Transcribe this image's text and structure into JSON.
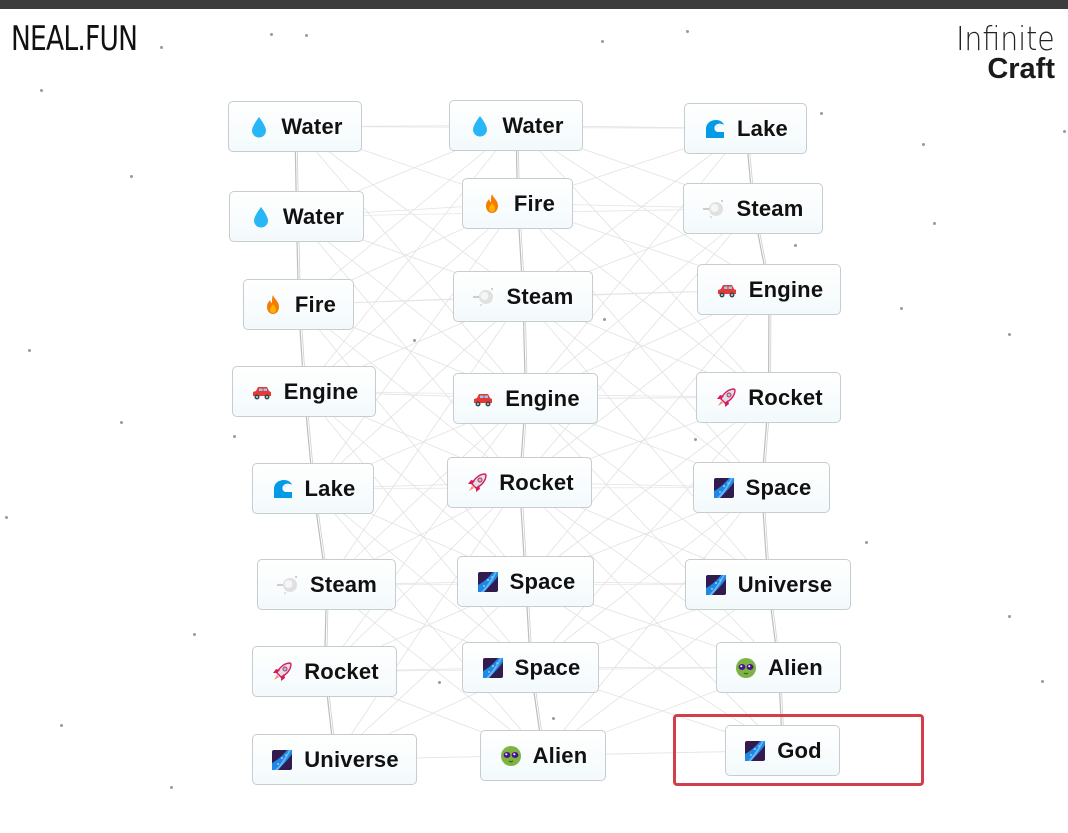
{
  "header": {
    "site_logo": "NEAL.FUN",
    "game_logo_line1": "Infinite",
    "game_logo_line2": "Craft"
  },
  "colors": {
    "topbar": "#3c3c3c",
    "highlight": "#d1404a",
    "item_border": "#c5ccd2",
    "line": "#d4d4d4"
  },
  "columns": [
    {
      "items": [
        {
          "label": "Water",
          "icon": "water-drop-icon"
        },
        {
          "label": "Water",
          "icon": "water-drop-icon"
        },
        {
          "label": "Fire",
          "icon": "fire-icon"
        },
        {
          "label": "Engine",
          "icon": "car-icon"
        },
        {
          "label": "Lake",
          "icon": "wave-icon"
        },
        {
          "label": "Steam",
          "icon": "steam-icon"
        },
        {
          "label": "Rocket",
          "icon": "rocket-icon"
        },
        {
          "label": "Universe",
          "icon": "milky-way-icon"
        }
      ]
    },
    {
      "items": [
        {
          "label": "Water",
          "icon": "water-drop-icon"
        },
        {
          "label": "Fire",
          "icon": "fire-icon"
        },
        {
          "label": "Steam",
          "icon": "steam-icon"
        },
        {
          "label": "Engine",
          "icon": "car-icon"
        },
        {
          "label": "Rocket",
          "icon": "rocket-icon"
        },
        {
          "label": "Space",
          "icon": "milky-way-icon"
        },
        {
          "label": "Space",
          "icon": "milky-way-icon"
        },
        {
          "label": "Alien",
          "icon": "alien-icon"
        }
      ]
    },
    {
      "items": [
        {
          "label": "Lake",
          "icon": "wave-icon"
        },
        {
          "label": "Steam",
          "icon": "steam-icon"
        },
        {
          "label": "Engine",
          "icon": "car-icon"
        },
        {
          "label": "Rocket",
          "icon": "rocket-icon"
        },
        {
          "label": "Space",
          "icon": "milky-way-icon"
        },
        {
          "label": "Universe",
          "icon": "milky-way-icon"
        },
        {
          "label": "Alien",
          "icon": "alien-icon"
        },
        {
          "label": "God",
          "icon": "milky-way-icon",
          "highlighted": true
        }
      ]
    }
  ]
}
